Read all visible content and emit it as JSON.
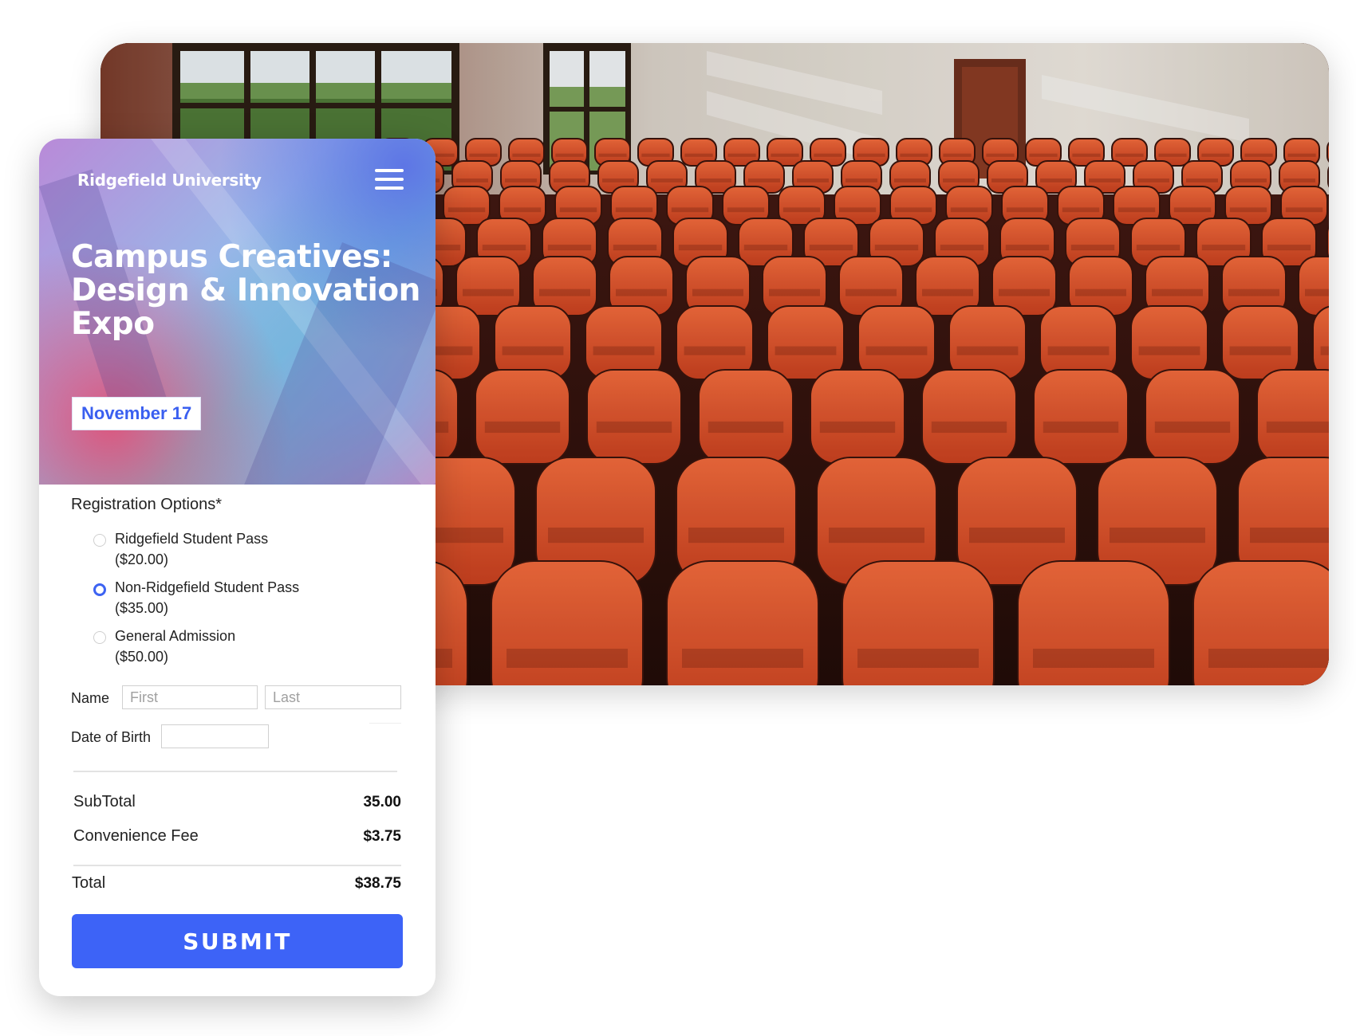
{
  "brand": {
    "name": "Ridgefield University"
  },
  "event": {
    "title": "Campus Creatives: Design & Innovation Expo",
    "date": "November 17"
  },
  "registration": {
    "label": "Registration Options*",
    "options": [
      {
        "name": "Ridgefield Student Pass",
        "price": "($20.00)",
        "selected": false
      },
      {
        "name": "Non-Ridgefield Student Pass",
        "price": "($35.00)",
        "selected": true
      },
      {
        "name": "General Admission",
        "price": "($50.00)",
        "selected": false
      }
    ]
  },
  "fields": {
    "name_label": "Name",
    "first_placeholder": "First",
    "last_placeholder": "Last",
    "dob_label": "Date of Birth",
    "dob_value": ""
  },
  "summary": {
    "subtotal_label": "SubTotal",
    "subtotal_value": "35.00",
    "fee_label": "Convenience Fee",
    "fee_value": "$3.75",
    "total_label": "Total",
    "total_value": "$38.75"
  },
  "actions": {
    "submit_label": "SUBMIT"
  },
  "colors": {
    "accent": "#3d63f7",
    "seat": "#e8552f",
    "badge_text": "#3a5ff0"
  },
  "icons": {
    "menu": "hamburger-menu-icon",
    "photo": "auditorium-seats-photo"
  }
}
